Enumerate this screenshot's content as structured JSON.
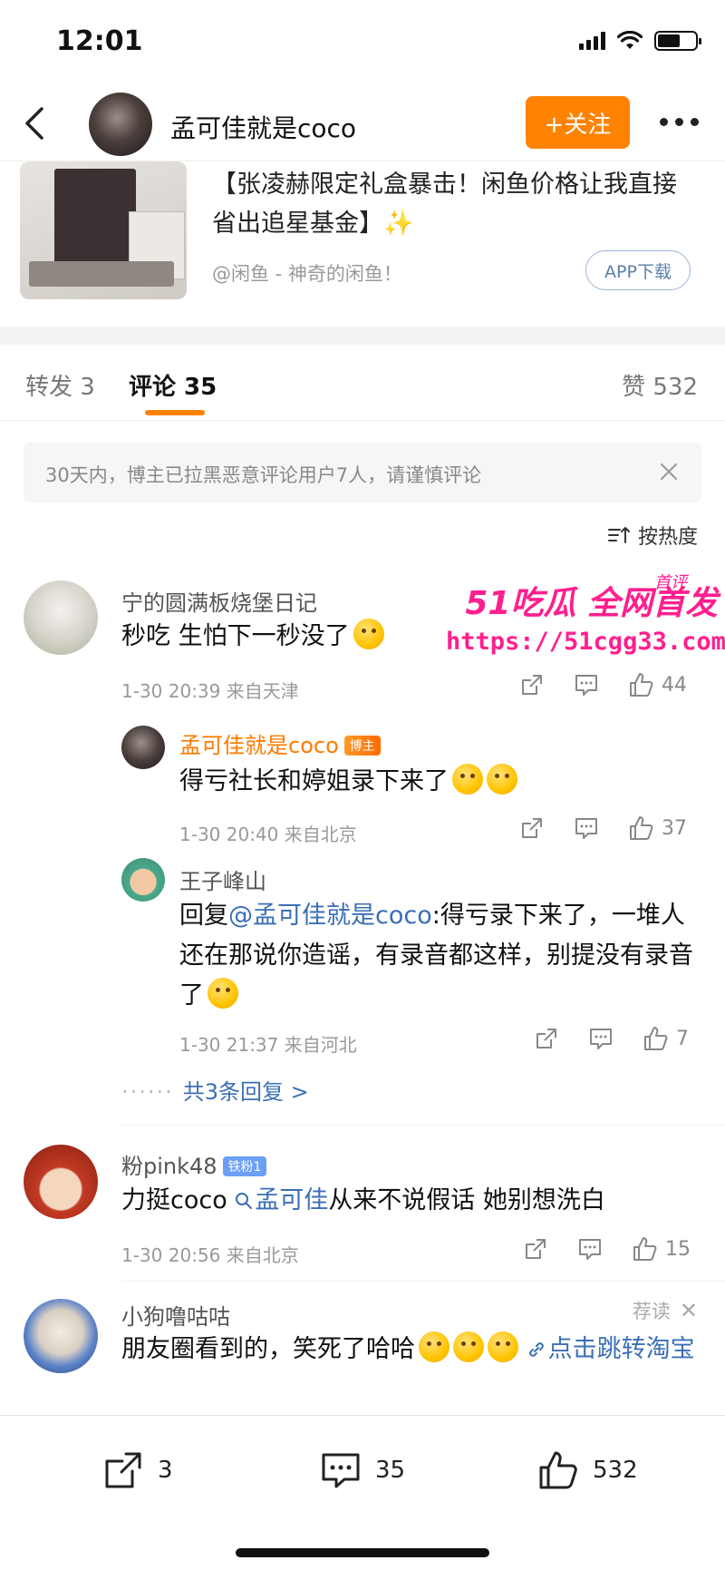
{
  "status_bar": {
    "time": "12:01"
  },
  "header": {
    "user_name": "孟可佳就是coco",
    "follow_label": "+关注"
  },
  "card": {
    "title": "【张凌赫限定礼盒暴击！闲鱼价格让我直接省出追星基金】✨",
    "source": "@闲鱼 - 神奇的闲鱼！",
    "app_button": "APP下载"
  },
  "tabs": {
    "repost": "转发 3",
    "comments": "评论 35",
    "likes": "赞 532"
  },
  "notice": {
    "text": "30天内，博主已拉黑恶意评论用户7人，请谨慎评论"
  },
  "sort_label": "按热度",
  "comments": [
    {
      "name": "宁的圆满板烧堡日记",
      "text": "秒吃 生怕下一秒没了",
      "meta": "1-30 20:39 来自天津",
      "likes": "44"
    },
    {
      "name": "粉pink48",
      "badge": "铁粉1",
      "text_prefix": "力挺coco ",
      "text_link": "孟可佳",
      "text_suffix": "从来不说假话 她别想洗白",
      "meta": "1-30 20:56 来自北京",
      "likes": "15"
    },
    {
      "name": "小狗噜咕咕",
      "recommend": "荐读",
      "text": "朋友圈看到的，笑死了哈哈",
      "link": "点击跳转淘宝"
    }
  ],
  "replies": [
    {
      "name": "孟可佳就是coco",
      "badge": "博主",
      "text": "得亏社长和婷姐录下来了",
      "meta": "1-30 20:40 来自北京",
      "likes": "37"
    },
    {
      "name": "王子峰山",
      "reply_prefix": "回复",
      "mention": "@孟可佳就是coco",
      "text": ":得亏录下来了，一堆人还在那说你造谣，有录音都这样，别提没有录音了",
      "meta": "1-30 21:37 来自河北",
      "likes": "7"
    }
  ],
  "more_replies": "共3条回复 >",
  "watermark": {
    "brand": "51吃瓜 全网首发",
    "first": "首评",
    "url": "https://51cgg33.com"
  },
  "bottom_bar": {
    "reposts": "3",
    "comments": "35",
    "likes": "532"
  },
  "colors": {
    "accent": "#ff8200",
    "link": "#3b6fb6",
    "watermark": "#ff1f8e"
  }
}
